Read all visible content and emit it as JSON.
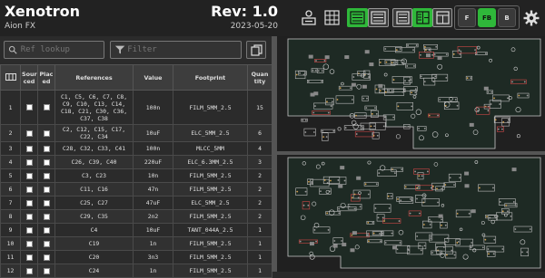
{
  "header": {
    "title": "Xenotron",
    "company": "Aion FX",
    "revision": "Rev: 1.0",
    "date": "2023-05-20"
  },
  "toolbar": {
    "layer_buttons": [
      "F",
      "FB",
      "B"
    ],
    "active_layer": "FB",
    "accent_color": "#2fb83a"
  },
  "filters": {
    "ref_lookup_placeholder": "Ref lookup",
    "filter_placeholder": "Filter"
  },
  "bom": {
    "columns": [
      "Sourced",
      "Placed",
      "References",
      "Value",
      "Footprint",
      "Quantity"
    ],
    "column_labels": {
      "sourced": "Sour\nced",
      "placed": "Plac\ned",
      "references": "References",
      "value": "Value",
      "footprint": "Footprint",
      "quantity": "Quan\ntity"
    },
    "rows": [
      {
        "n": "1",
        "refs": "C1, C5, C6, C7, C8, C9, C10, C13, C14, C18, C21, C30, C36, C37, C38",
        "value": "100n",
        "footprint": "FILM_5MM_2.5",
        "qty": "15"
      },
      {
        "n": "2",
        "refs": "C2, C12, C15, C17, C22, C34",
        "value": "10uF",
        "footprint": "ELC_5MM_2.5",
        "qty": "6"
      },
      {
        "n": "3",
        "refs": "C28, C32, C33, C41",
        "value": "100n",
        "footprint": "MLCC_5MM",
        "qty": "4"
      },
      {
        "n": "4",
        "refs": "C26, C39, C40",
        "value": "220uF",
        "footprint": "ELC_6.3MM_2.5",
        "qty": "3"
      },
      {
        "n": "5",
        "refs": "C3, C23",
        "value": "10n",
        "footprint": "FILM_5MM_2.5",
        "qty": "2"
      },
      {
        "n": "6",
        "refs": "C11, C16",
        "value": "47n",
        "footprint": "FILM_5MM_2.5",
        "qty": "2"
      },
      {
        "n": "7",
        "refs": "C25, C27",
        "value": "47uF",
        "footprint": "ELC_5MM_2.5",
        "qty": "2"
      },
      {
        "n": "8",
        "refs": "C29, C35",
        "value": "2n2",
        "footprint": "FILM_5MM_2.5",
        "qty": "2"
      },
      {
        "n": "9",
        "refs": "C4",
        "value": "10uF",
        "footprint": "TANT_044A_2.5",
        "qty": "1"
      },
      {
        "n": "10",
        "refs": "C19",
        "value": "1n",
        "footprint": "FILM_5MM_2.5",
        "qty": "1"
      },
      {
        "n": "11",
        "refs": "C20",
        "value": "3n3",
        "footprint": "FILM_5MM_2.5",
        "qty": "1"
      },
      {
        "n": "12",
        "refs": "C24",
        "value": "1n",
        "footprint": "FILM_5MM_2.5",
        "qty": "1"
      }
    ]
  }
}
